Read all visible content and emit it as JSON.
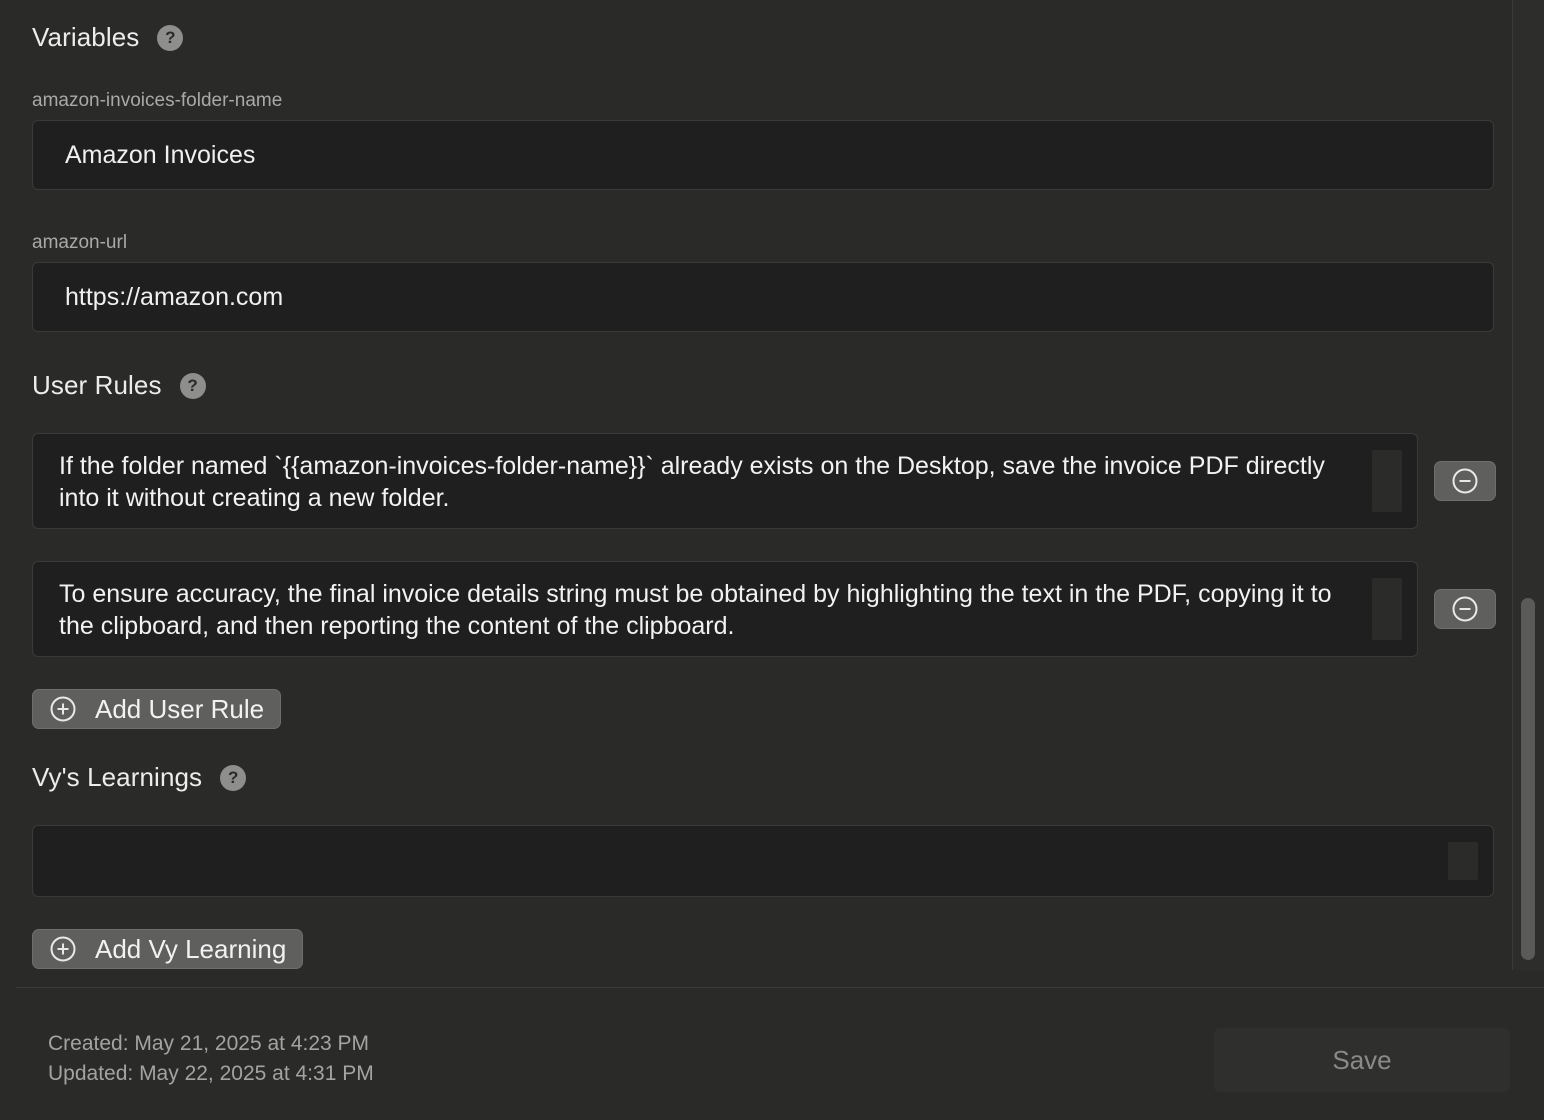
{
  "variables": {
    "title": "Variables",
    "help_icon": "question-icon",
    "items": [
      {
        "name": "amazon-invoices-folder-name",
        "value": "Amazon Invoices"
      },
      {
        "name": "amazon-url",
        "value": "https://amazon.com"
      }
    ]
  },
  "user_rules": {
    "title": "User Rules",
    "help_icon": "question-icon",
    "rules": [
      {
        "text": "If the folder named `{{amazon-invoices-folder-name}}` already exists on the Desktop, save the invoice PDF directly into it without creating a new folder."
      },
      {
        "text": "To ensure accuracy, the final invoice details string must be obtained by highlighting the text in the PDF, copying it to the clipboard, and then reporting the content of the clipboard."
      }
    ],
    "add_label": "Add User Rule"
  },
  "learnings": {
    "title": "Vy's Learnings",
    "help_icon": "question-icon",
    "value": "",
    "add_label": "Add Vy Learning"
  },
  "footer": {
    "created": "Created: May 21, 2025 at 4:23 PM",
    "updated": "Updated: May 22, 2025 at 4:31 PM",
    "save_label": "Save"
  },
  "colors": {
    "background": "#2a2b29",
    "field_background": "#1f1f1f",
    "button_background": "#5f605e"
  }
}
